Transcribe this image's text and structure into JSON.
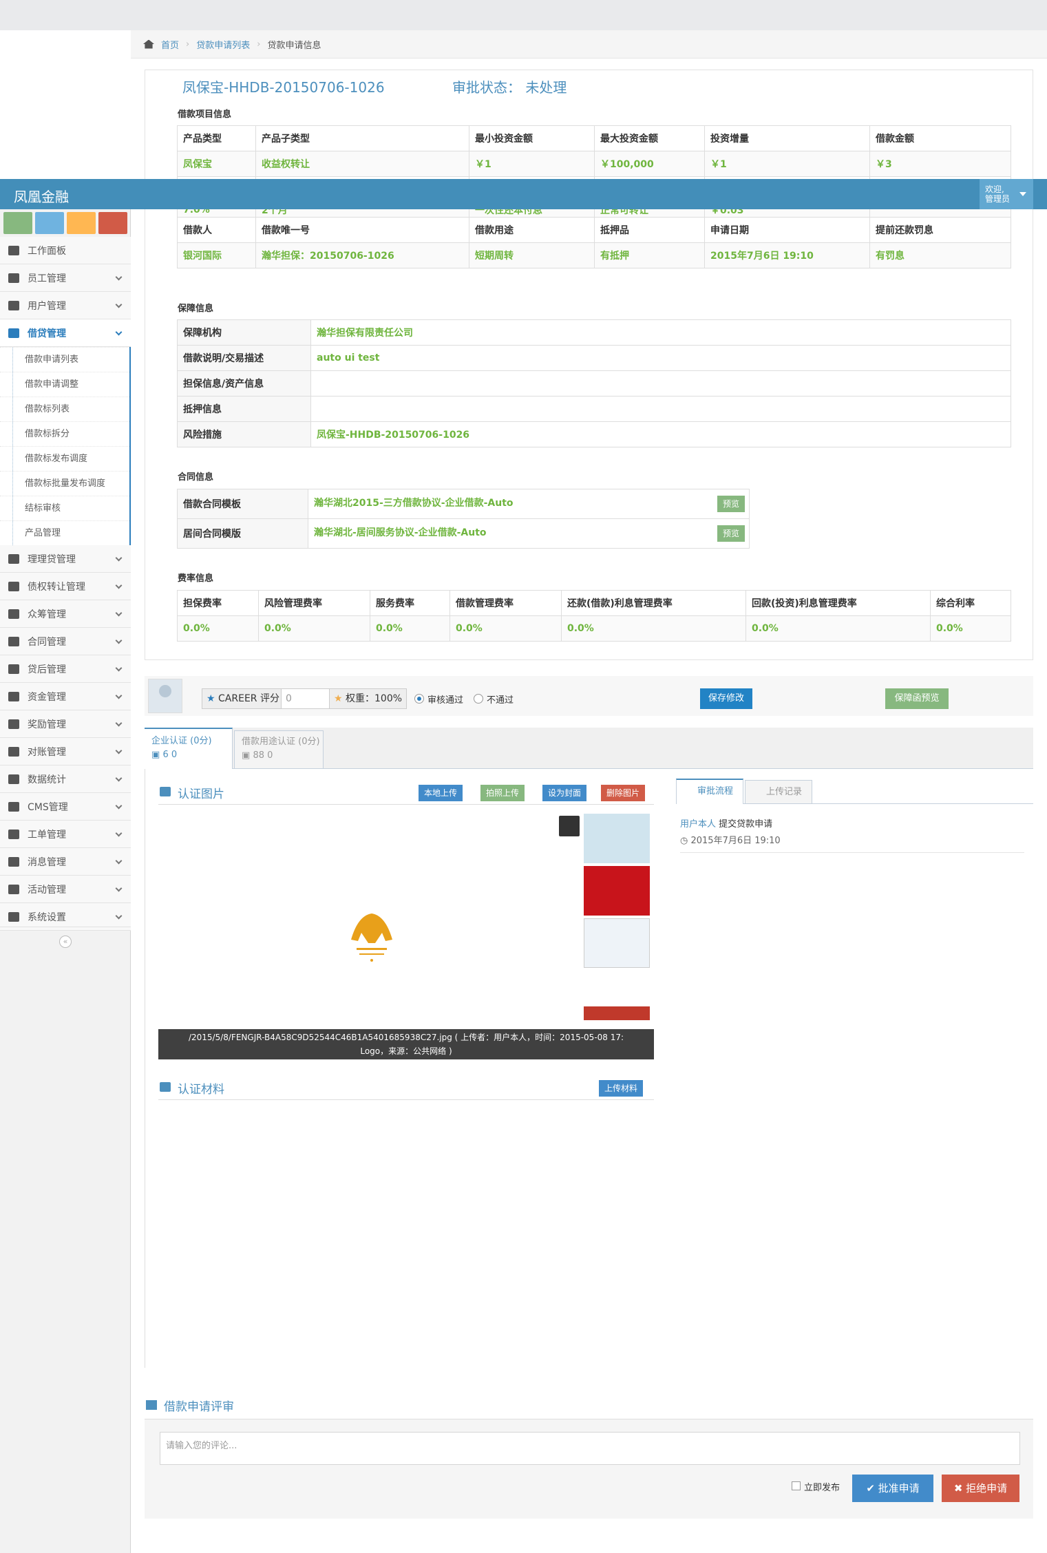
{
  "app": {
    "brand": "凤凰金融",
    "user_line1": "欢迎,",
    "user_line2": "管理员"
  },
  "breadcrumb": {
    "home": "首页",
    "list": "贷款申请列表",
    "current": "贷款申请信息"
  },
  "sidebar": {
    "items": [
      {
        "label": "工作面板"
      },
      {
        "label": "员工管理"
      },
      {
        "label": "用户管理"
      },
      {
        "label": "借贷管理"
      }
    ],
    "sub_items": [
      "借款申请列表",
      "借款申请调整",
      "借款标列表",
      "借款标拆分",
      "借款标发布调度",
      "借款标批量发布调度",
      "结标审核",
      "产品管理"
    ],
    "items2": [
      {
        "label": "理理贷管理"
      },
      {
        "label": "债权转让管理"
      },
      {
        "label": "众筹管理"
      },
      {
        "label": "合同管理"
      },
      {
        "label": "贷后管理"
      },
      {
        "label": "资金管理"
      },
      {
        "label": "奖励管理"
      },
      {
        "label": "对账管理"
      },
      {
        "label": "数据统计"
      },
      {
        "label": "CMS管理"
      },
      {
        "label": "工单管理"
      },
      {
        "label": "消息管理"
      },
      {
        "label": "活动管理"
      },
      {
        "label": "系统设置"
      }
    ]
  },
  "loan": {
    "title": "凤保宝-HHDB-20150706-1026",
    "status": "审批状态：  未处理"
  },
  "sections": {
    "project": "借款项目信息",
    "guarantee": "保障信息",
    "contract": "合同信息",
    "fees": "费率信息"
  },
  "project_table": {
    "h1": [
      "产品类型",
      "产品子类型",
      "最小投资金额",
      "最大投资金额",
      "投资增量",
      "借款金额"
    ],
    "v1": [
      "凤保宝",
      "收益权转让",
      "￥1",
      "￥100,000",
      "￥1",
      "￥3"
    ],
    "v2": [
      "7.0%",
      "2个月",
      "一次性还本付息",
      "正常可转让",
      "￥0.03",
      ""
    ],
    "h3": [
      "借款人",
      "借款唯一号",
      "借款用途",
      "抵押品",
      "申请日期",
      "提前还款罚息"
    ],
    "v3": [
      "银河国际",
      "瀚华担保：20150706-1026",
      "短期周转",
      "有抵押",
      "2015年7月6日 19:10",
      "有罚息"
    ]
  },
  "guarantee_table": [
    {
      "label": "保障机构",
      "value": "瀚华担保有限责任公司"
    },
    {
      "label": "借款说明/交易描述",
      "value": "auto ui test"
    },
    {
      "label": "担保信息/资产信息",
      "value": ""
    },
    {
      "label": "抵押信息",
      "value": ""
    },
    {
      "label": "风险措施",
      "value": "凤保宝-HHDB-20150706-1026"
    }
  ],
  "contract_table": [
    {
      "label": "借款合同模板",
      "value": "瀚华湖北2015-三方借款协议-企业借款-Auto",
      "btn": "预览"
    },
    {
      "label": "居间合同模版",
      "value": "瀚华湖北-居间服务协议-企业借款-Auto",
      "btn": "预览"
    }
  ],
  "fee_table": {
    "headers": [
      "担保费率",
      "风险管理费率",
      "服务费率",
      "借款管理费率",
      "还款(借款)利息管理费率",
      "回款(投资)利息管理费率",
      "综合利率"
    ],
    "values": [
      "0.0%",
      "0.0%",
      "0.0%",
      "0.0%",
      "0.0%",
      "0.0%",
      "0.0%"
    ]
  },
  "scoring": {
    "career": "CAREER 评分",
    "career_value": "0",
    "weight": "权重：100%",
    "pass": "审核通过",
    "fail": "不通过",
    "save": "保存修改",
    "preview": "保障函预览"
  },
  "tabs": [
    {
      "label": "企业认证 (0分)",
      "counts": "6   0"
    },
    {
      "label": "借款用途认证 (0分)",
      "counts": "88   0"
    }
  ],
  "images": {
    "title": "认证图片",
    "local_upload": "本地上传",
    "photo_upload": "拍照上传",
    "set_cover": "设为封面",
    "delete": "删除图片",
    "caption1": "/2015/5/8/FENGJR-B4A58C9D52544C46B1A5401685938C27.jpg ( 上传者：用户本人，时间：2015-05-08 17:",
    "caption2": "Logo，来源：公共网络 )"
  },
  "materials": {
    "title": "认证材料",
    "upload": "上传材料"
  },
  "right": {
    "tab1": "审批流程",
    "tab2": "上传记录",
    "user": "用户本人",
    "action": " 提交贷款申请",
    "time": "2015年7月6日 19:10"
  },
  "comment": {
    "title": "借款申请评审",
    "placeholder": "请输入您的评论...",
    "publish": "立即发布",
    "approve": "批准申请",
    "reject": "拒绝申请"
  },
  "colors": {
    "accent": "#438eb9",
    "green": "#6fb53e",
    "red": "#d15b47"
  }
}
